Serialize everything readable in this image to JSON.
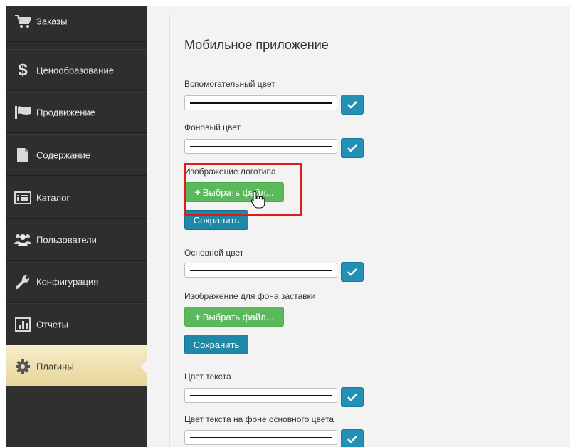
{
  "sidebar": {
    "items": [
      {
        "label": "Заказы",
        "icon": "cart-icon"
      },
      {
        "label": "Ценообразование",
        "icon": "dollar-icon"
      },
      {
        "label": "Продвижение",
        "icon": "flag-icon"
      },
      {
        "label": "Содержание",
        "icon": "document-icon"
      },
      {
        "label": "Каталог",
        "icon": "list-icon"
      },
      {
        "label": "Пользователи",
        "icon": "users-icon"
      },
      {
        "label": "Конфигурация",
        "icon": "wrench-icon"
      },
      {
        "label": "Отчеты",
        "icon": "bar-chart-icon"
      },
      {
        "label": "Плагины",
        "icon": "gear-icon",
        "active": true
      }
    ]
  },
  "main": {
    "title": "Мобильное приложение",
    "fields": {
      "secondary_color": "Вспомогательный цвет",
      "background_color": "Фоновый цвет",
      "logo_image": "Изображение логотипа",
      "primary_color": "Основной цвет",
      "splash_bg_image": "Изображение для фона заставки",
      "text_color": "Цвет текста",
      "text_on_primary": "Цвет текста на фоне основного цвета"
    },
    "choose_file": "Выбрать файл...",
    "save": "Сохранить",
    "plus_symbol": "+"
  },
  "colors": {
    "sidebar_bg": "#2e2e2e",
    "active_item": "#efe1ab",
    "confirm_button": "#2390b5",
    "upload_button": "#5cb85c",
    "save_button": "#1e88a8",
    "highlight_border": "#e01b1b"
  }
}
